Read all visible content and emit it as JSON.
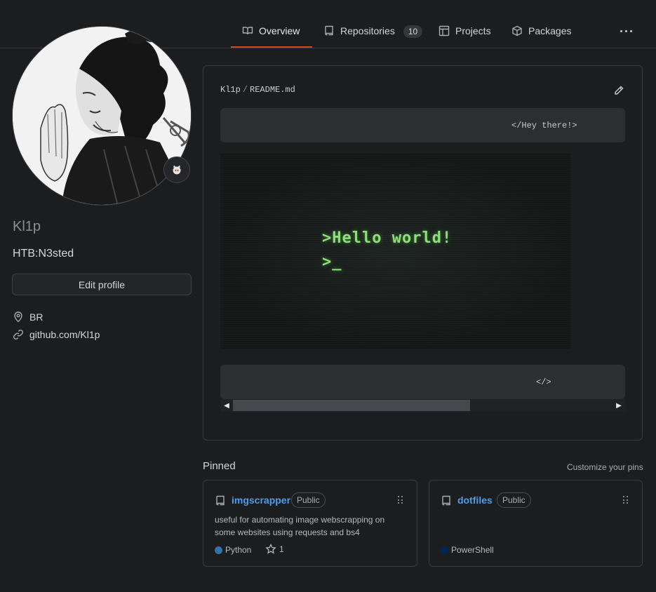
{
  "nav": {
    "tabs": [
      {
        "label": "Overview",
        "icon": "book-icon",
        "active": true
      },
      {
        "label": "Repositories",
        "icon": "repo-icon",
        "count": "10"
      },
      {
        "label": "Projects",
        "icon": "table-icon"
      },
      {
        "label": "Packages",
        "icon": "package-icon"
      }
    ],
    "accent_color": "#c9472b"
  },
  "profile": {
    "username": "Kl1p",
    "bio": "HTB:N3sted",
    "edit_label": "Edit profile",
    "location": "BR",
    "website": "github.com/Kl1p"
  },
  "readme": {
    "owner": "Kl1p",
    "separator": "/",
    "file": "README.md",
    "code1": "</Hey there!>",
    "gif_line1": ">Hello world!",
    "gif_line2": ">_",
    "code2": "</>"
  },
  "pinned": {
    "title": "Pinned",
    "customize": "Customize your pins",
    "repos": [
      {
        "name": "imgscrapper",
        "visibility": "Public",
        "description": "useful for automating image webscrapping on some websites using requests and bs4",
        "language": "Python",
        "language_color": "#3572A5",
        "stars": "1"
      },
      {
        "name": "dotfiles",
        "visibility": "Public",
        "description": "",
        "language": "PowerShell",
        "language_color": "#012456"
      }
    ]
  }
}
